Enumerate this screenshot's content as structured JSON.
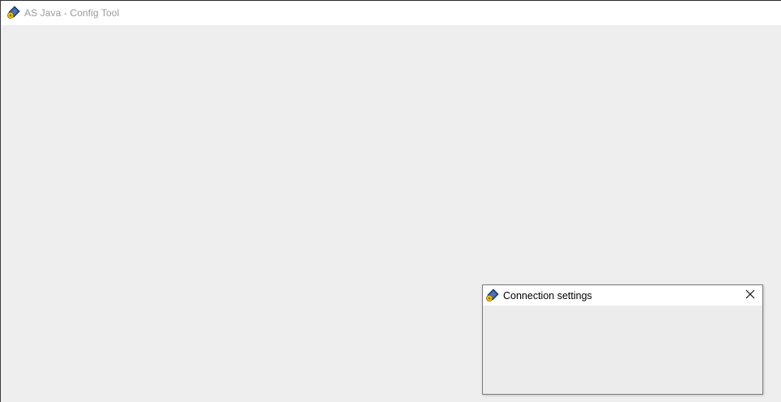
{
  "main_window": {
    "title": "AS Java - Config Tool",
    "icon": "java-config-tool-icon"
  },
  "dialog": {
    "title": "Connection settings",
    "icon": "java-config-tool-icon",
    "close_icon": "close-icon"
  },
  "colors": {
    "client_background": "#eeeeee",
    "titlebar_background": "#ffffff",
    "inactive_title_text": "#9a9a9a",
    "active_title_text": "#000000"
  }
}
